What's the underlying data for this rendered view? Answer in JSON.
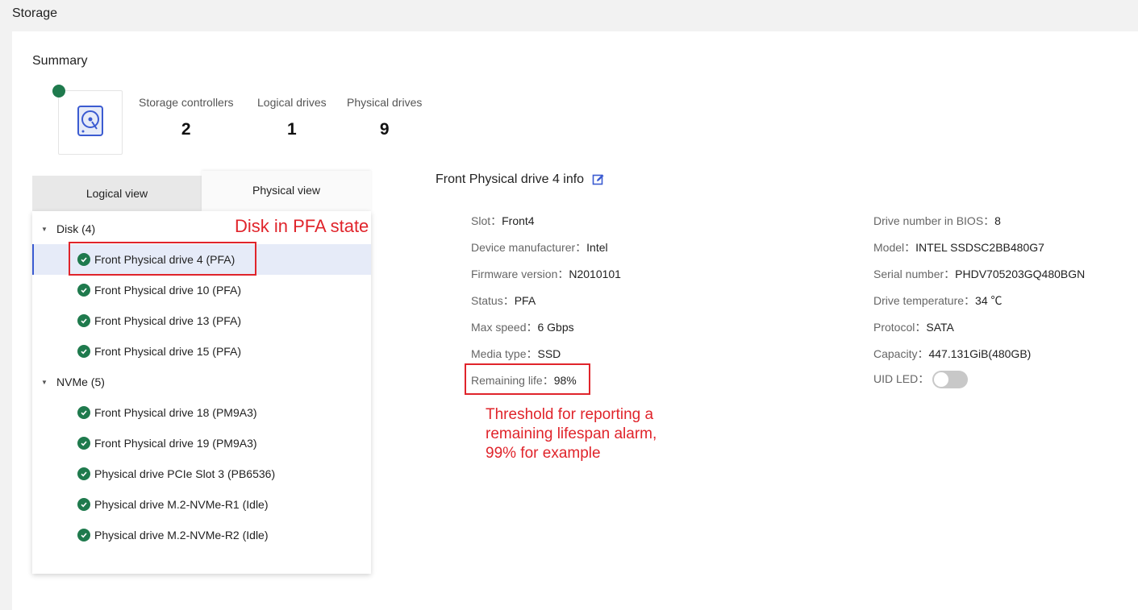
{
  "page": {
    "title": "Storage"
  },
  "summary": {
    "title": "Summary",
    "icon": "hard-drive-icon",
    "status_color": "#1f7a4d",
    "stats": [
      {
        "label": "Storage controllers",
        "value": "2"
      },
      {
        "label": "Logical drives",
        "value": "1"
      },
      {
        "label": "Physical drives",
        "value": "9"
      }
    ]
  },
  "tabs": {
    "logical": "Logical view",
    "physical": "Physical view",
    "active": "Physical view"
  },
  "tree": {
    "groups": [
      {
        "label": "Disk (4)",
        "items": [
          "Front Physical drive 4 (PFA)",
          "Front Physical drive 10 (PFA)",
          "Front Physical drive 13 (PFA)",
          "Front Physical drive 15 (PFA)"
        ]
      },
      {
        "label": "NVMe (5)",
        "items": [
          "Front Physical drive 18 (PM9A3)",
          "Front Physical drive 19 (PM9A3)",
          "Physical drive PCIe Slot 3 (PB6536)",
          "Physical drive M.2-NVMe-R1 (Idle)",
          "Physical drive M.2-NVMe-R2 (Idle)"
        ]
      }
    ],
    "selected": "Front Physical drive 4 (PFA)"
  },
  "info": {
    "title": "Front Physical drive 4 info",
    "left": [
      {
        "key": "Slot",
        "value": "Front4"
      },
      {
        "key": "Device manufacturer",
        "value": "Intel"
      },
      {
        "key": "Firmware version",
        "value": "N2010101"
      },
      {
        "key": "Status",
        "value": "PFA"
      },
      {
        "key": "Max speed",
        "value": "6 Gbps"
      },
      {
        "key": "Media type",
        "value": "SSD"
      },
      {
        "key": "Remaining life",
        "value": "98%"
      }
    ],
    "right": [
      {
        "key": "Drive number in BIOS",
        "value": "8"
      },
      {
        "key": "Model",
        "value": "INTEL SSDSC2BB480G7"
      },
      {
        "key": "Serial number",
        "value": "PHDV705203GQ480BGN"
      },
      {
        "key": "Drive temperature",
        "value": "34 ℃"
      },
      {
        "key": "Protocol",
        "value": "SATA"
      },
      {
        "key": "Capacity",
        "value": "447.131GiB(480GB)"
      },
      {
        "key": "UID LED",
        "value": "off"
      }
    ],
    "separator": "："
  },
  "annotations": {
    "pfa": "Disk in PFA state",
    "threshold": [
      "Threshold for reporting a",
      "remaining lifespan alarm,",
      "99% for example"
    ]
  },
  "colors": {
    "accent": "#3b5bd1",
    "ok": "#1f7a4d",
    "annotation": "#e0242b"
  }
}
